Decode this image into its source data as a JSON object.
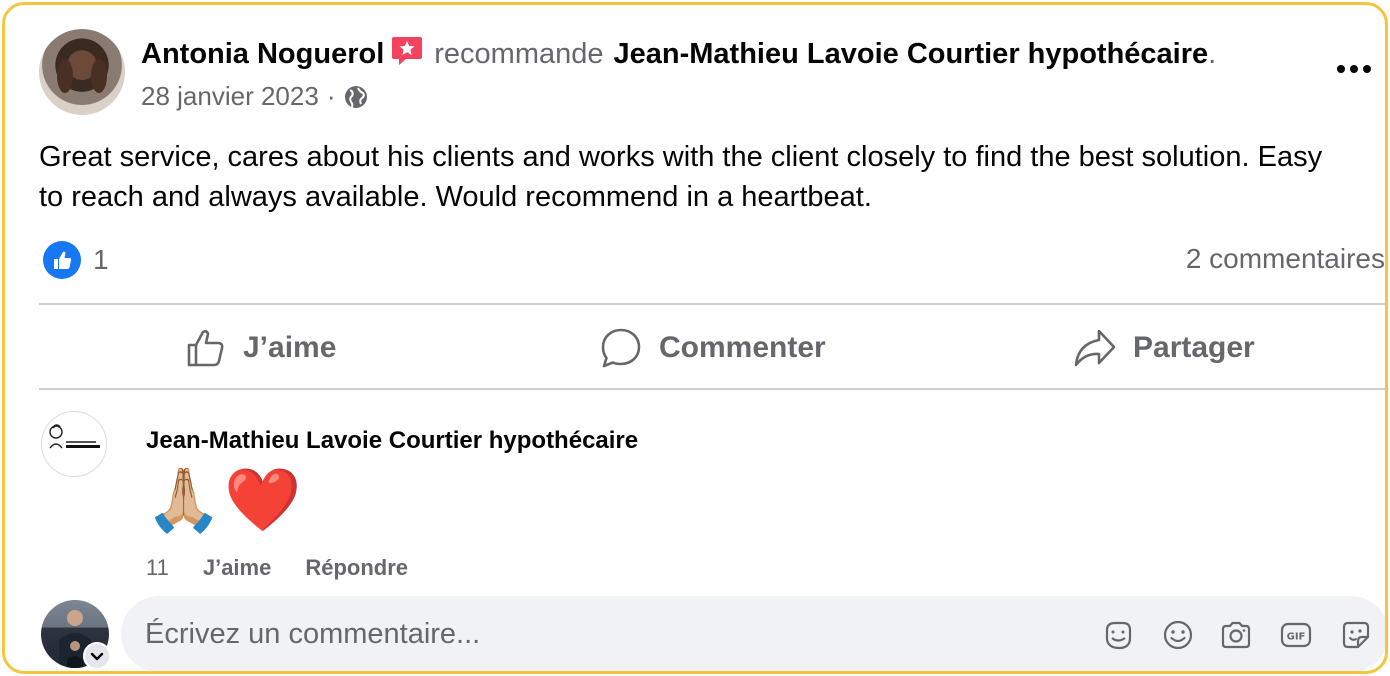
{
  "post": {
    "author": "Antonia Noguerol",
    "action_word": "recommande",
    "page_name": "Jean-Mathieu Lavoie Courtier hypothécaire",
    "period": ".",
    "date": "28 janvier 2023",
    "separator": "·",
    "audience_icon": "globe-icon",
    "text": "Great service, cares about his clients and works with the client closely to find the best solution. Easy to reach and always available. Would recommend in a heartbeat.",
    "like_count": "1",
    "comments_count": "2 commentaires"
  },
  "actions": {
    "like_label": "J’aime",
    "comment_label": "Commenter",
    "share_label": "Partager"
  },
  "comment": {
    "author": "Jean-Mathieu Lavoie Courtier hypothécaire",
    "emoji_1": "🙏🏼",
    "emoji_2": "❤️",
    "time": "11",
    "like_label": "J’aime",
    "reply_label": "Répondre"
  },
  "composer": {
    "placeholder": "Écrivez un commentaire..."
  },
  "colors": {
    "accent": "#1877f2",
    "frame": "#f5c542",
    "recommend_badge": "#f3425f",
    "secondary_text": "#65676b"
  }
}
